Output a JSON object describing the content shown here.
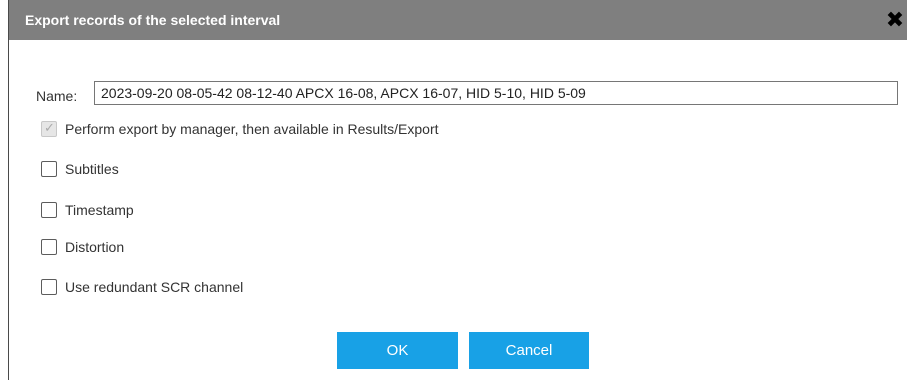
{
  "dialog": {
    "title": "Export records of the selected interval",
    "close_icon": "close-icon"
  },
  "name_field": {
    "label": "Name:",
    "value": "2023-09-20 08-05-42 08-12-40 APCX 16-08, APCX 16-07, HID 5-10, HID 5-09"
  },
  "options": [
    {
      "label": "Perform export by manager, then available in Results/Export",
      "checked": true,
      "disabled": true
    },
    {
      "label": "Subtitles",
      "checked": false,
      "disabled": false
    },
    {
      "label": "Timestamp",
      "checked": false,
      "disabled": false
    },
    {
      "label": "Distortion",
      "checked": false,
      "disabled": false
    },
    {
      "label": "Use redundant SCR channel",
      "checked": false,
      "disabled": false
    }
  ],
  "buttons": {
    "ok_label": "OK",
    "cancel_label": "Cancel"
  },
  "colors": {
    "titlebar": "#7f7f7f",
    "button": "#18a1e6"
  }
}
